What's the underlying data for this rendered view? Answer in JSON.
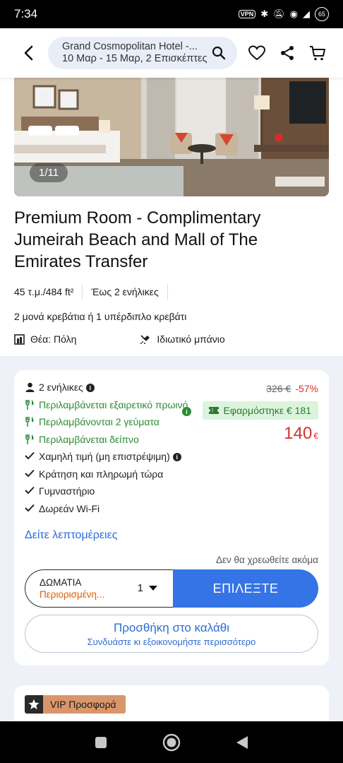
{
  "status_bar": {
    "time": "7:34",
    "vpn": "VPN",
    "battery": "65"
  },
  "search": {
    "line1": "Grand Cosmopolitan Hotel -...",
    "line2": "10 Μαρ - 15 Μαρ, 2 Επισκέπτες"
  },
  "gallery": {
    "counter": "1/11"
  },
  "room": {
    "title": "Premium Room - Complimentary Jumeirah Beach and Mall of The Emirates Transfer",
    "size": "45 τ.μ./484 ft²",
    "capacity": "Έως 2 ενήλικες",
    "beds": "2 μονά κρεβάτια ή 1 υπέρδιπλο κρεβάτι",
    "view": "Θέα: Πόλη",
    "bathroom": "Ιδιωτικό μπάνιο"
  },
  "offer": {
    "guests": "2 ενήλικες",
    "features": [
      {
        "text": "Περιλαμβάνεται εξαιρετικό πρωινό",
        "kind": "meal"
      },
      {
        "text": "Περιλαμβάνονται 2 γεύματα",
        "kind": "meal"
      },
      {
        "text": "Περιλαμβάνεται δείπνο",
        "kind": "meal"
      },
      {
        "text": "Χαμηλή τιμή (μη επιστρέψιμη)",
        "kind": "check"
      },
      {
        "text": "Κράτηση και πληρωμή τώρα",
        "kind": "check"
      },
      {
        "text": "Γυμναστήριο",
        "kind": "check"
      },
      {
        "text": "Δωρεάν Wi-Fi",
        "kind": "check"
      }
    ],
    "old_price": "326 €",
    "discount": "-57%",
    "coupon_applied": "Εφαρμόστηκε € 181",
    "price": "140",
    "currency": "€",
    "details_link": "Δείτε λεπτομέρειες",
    "not_charged": "Δεν θα χρεωθείτε ακόμα",
    "room_label": "ΔΩΜΑΤΙΑ",
    "room_limited": "Περιορισμένη...",
    "room_qty": "1",
    "select_label": "ΕΠΙΛΕΞΤΕ",
    "cart_label": "Προσθήκη στο καλάθι",
    "cart_sub": "Συνδυάστε κι εξοικονομήστε περισσότερο"
  },
  "next_offer": {
    "badge": "VIP Προσφορά"
  },
  "colors": {
    "accent": "#3474e6",
    "green": "#2d8a34",
    "red": "#d6302b",
    "orange": "#e05a00"
  }
}
